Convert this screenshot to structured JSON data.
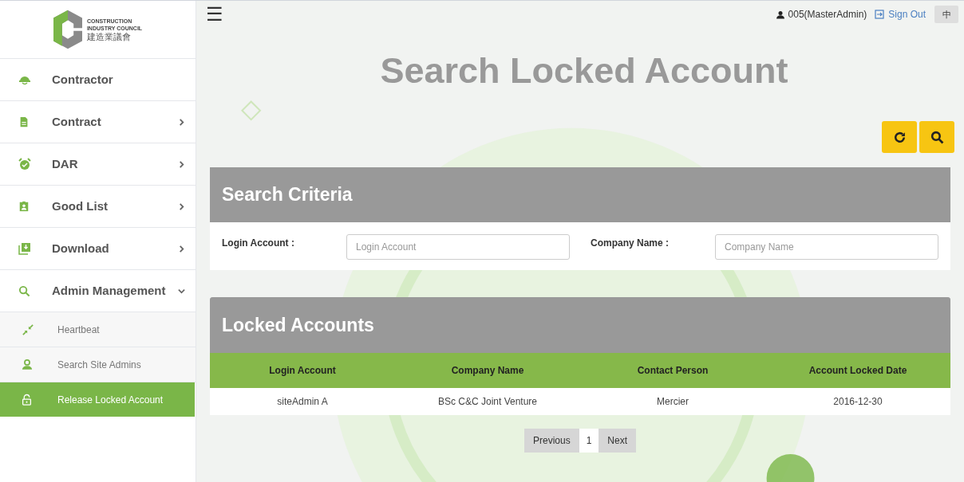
{
  "logo": {
    "line_1": "CONSTRUCTION",
    "line_2": "INDUSTRY COUNCIL",
    "line_3": "建造業議會"
  },
  "sidebar": {
    "items": [
      {
        "label": "Contractor",
        "kind": "link"
      },
      {
        "label": "Contract",
        "kind": "group",
        "expanded": false
      },
      {
        "label": "DAR",
        "kind": "group",
        "expanded": false
      },
      {
        "label": "Good List",
        "kind": "group",
        "expanded": false
      },
      {
        "label": "Download",
        "kind": "group",
        "expanded": false
      },
      {
        "label": "Admin Management",
        "kind": "group",
        "expanded": true,
        "children": [
          {
            "label": "Heartbeat",
            "selected": false
          },
          {
            "label": "Search Site Admins",
            "selected": false
          },
          {
            "label": "Release Locked Account",
            "selected": true
          }
        ]
      }
    ]
  },
  "header": {
    "menu_glyph": "☰",
    "user": "005(MasterAdmin)",
    "sign_out": "Sign Out",
    "language": "中"
  },
  "page_title": "Search Locked Account",
  "search_criteria": {
    "title": "Search Criteria",
    "fields": [
      {
        "label": "Login Account :",
        "placeholder": "Login Account"
      },
      {
        "label": "Company Name :",
        "placeholder": "Company Name"
      }
    ]
  },
  "table": {
    "title": "Locked Accounts",
    "columns": [
      "Login Account",
      "Company Name",
      "Contact Person",
      "Account Locked Date"
    ],
    "rows": [
      [
        "siteAdmin A",
        "BSc C&C Joint Venture",
        "Mercier",
        "2016-12-30"
      ]
    ]
  },
  "pagination": {
    "previous": "Previous",
    "pages": [
      {
        "label": "1",
        "selected": true
      }
    ],
    "next": "Next"
  }
}
